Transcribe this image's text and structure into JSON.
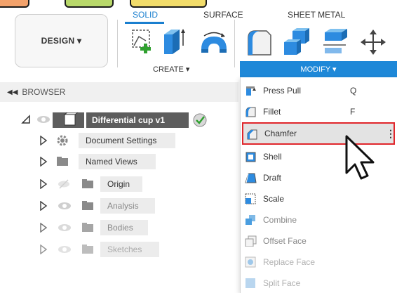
{
  "toolbar": {
    "tabs": [
      {
        "label": "SOLID",
        "active": true
      },
      {
        "label": "SURFACE",
        "active": false
      },
      {
        "label": "SHEET METAL",
        "active": false
      }
    ],
    "workspace_label": "DESIGN ▾",
    "create_label": "CREATE ▾",
    "modify_label": "MODIFY ▾"
  },
  "browser": {
    "header": "BROWSER",
    "collapse_icon": "double-left-chevron",
    "root": {
      "label": "Differential cup v1"
    },
    "items": [
      {
        "label": "Document Settings",
        "icon": "gear-icon"
      },
      {
        "label": "Named Views",
        "icon": "folder-icon"
      },
      {
        "label": "Origin",
        "icon": "folder-icon"
      },
      {
        "label": "Analysis",
        "icon": "folder-icon"
      },
      {
        "label": "Bodies",
        "icon": "folder-icon"
      },
      {
        "label": "Sketches",
        "icon": "folder-icon"
      }
    ]
  },
  "modify_menu": {
    "items": [
      {
        "label": "Press Pull",
        "key": "Q"
      },
      {
        "label": "Fillet",
        "key": "F"
      },
      {
        "label": "Chamfer",
        "key": "",
        "more": "⋮"
      },
      {
        "label": "Shell",
        "key": ""
      },
      {
        "label": "Draft",
        "key": ""
      },
      {
        "label": "Scale",
        "key": ""
      },
      {
        "label": "Combine",
        "key": ""
      },
      {
        "label": "Offset Face",
        "key": ""
      },
      {
        "label": "Replace Face",
        "key": ""
      },
      {
        "label": "Split Face",
        "key": ""
      }
    ]
  },
  "colors": {
    "accent": "#1e88d8",
    "highlight_border": "#e0262b",
    "top_button_orange": "#f3a26b",
    "top_button_green": "#b8d86a",
    "top_button_yellow": "#f2dc6a"
  }
}
